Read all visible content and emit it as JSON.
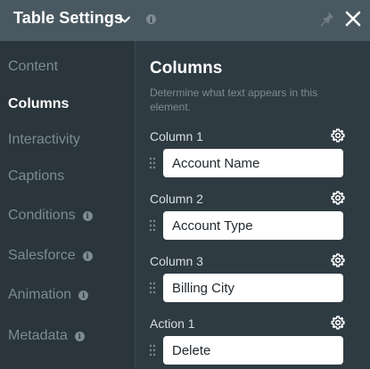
{
  "header": {
    "title": "Table Settings"
  },
  "sidebar": {
    "items": [
      {
        "label": "Content",
        "active": false,
        "info": false
      },
      {
        "label": "Columns",
        "active": true,
        "info": false
      },
      {
        "label": "Interactivity",
        "active": false,
        "info": false
      },
      {
        "label": "Captions",
        "active": false,
        "info": false
      },
      {
        "label": "Conditions",
        "active": false,
        "info": true
      },
      {
        "label": "Salesforce",
        "active": false,
        "info": true
      },
      {
        "label": "Animation",
        "active": false,
        "info": true
      },
      {
        "label": "Metadata",
        "active": false,
        "info": true
      }
    ]
  },
  "main": {
    "title": "Columns",
    "description": "Determine what text appears in this element.",
    "columns": [
      {
        "label": "Column 1",
        "value": "Account Name"
      },
      {
        "label": "Column 2",
        "value": "Account Type"
      },
      {
        "label": "Column 3",
        "value": "Billing City"
      },
      {
        "label": "Action 1",
        "value": "Delete"
      }
    ]
  },
  "colors": {
    "header_bg": "#4a5961",
    "sidebar_bg": "#2a353c",
    "main_bg": "#2f3b43",
    "muted_text": "#7e8b92"
  }
}
